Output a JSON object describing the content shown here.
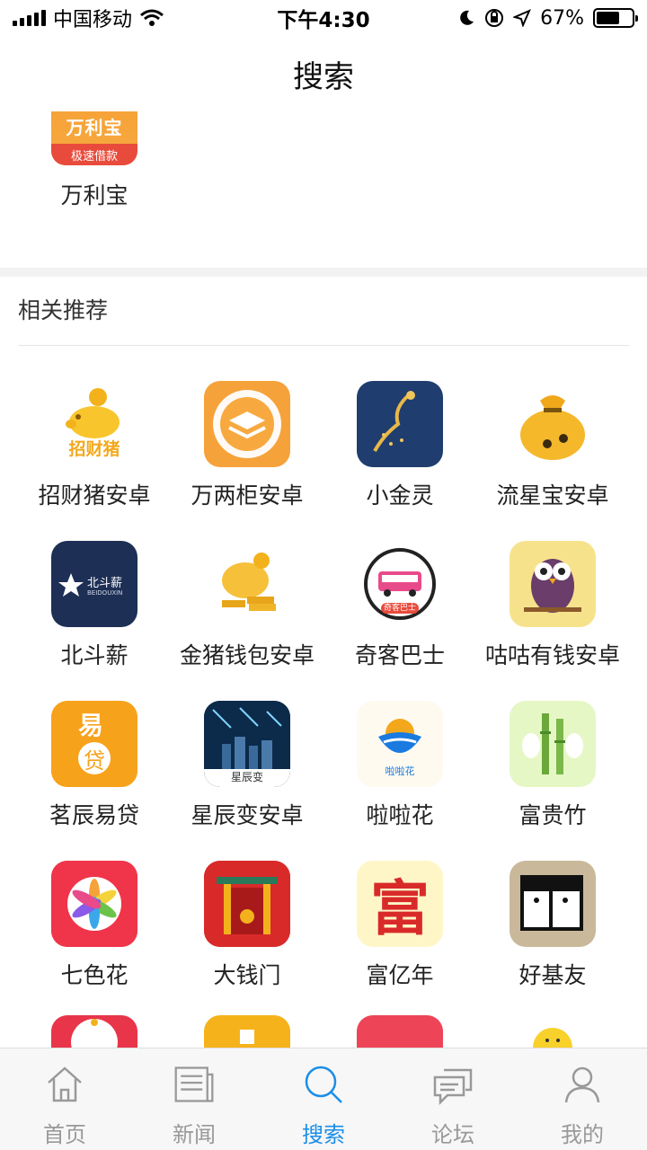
{
  "status_bar": {
    "carrier": "中国移动",
    "time": "下午4:30",
    "battery_text": "67%",
    "battery_level": 0.67
  },
  "header": {
    "title": "搜索"
  },
  "top_result": {
    "name": "万利宝",
    "icon_text_top": "万利宝",
    "icon_text_bottom": "极速借款"
  },
  "section": {
    "title": "相关推荐"
  },
  "apps": [
    {
      "name": "招财猪安卓",
      "icon": "pig-coin-icon",
      "icon_text": "招财猪",
      "bg": "#ffffff"
    },
    {
      "name": "万两柜安卓",
      "icon": "layers-icon",
      "bg": "#f6a23a"
    },
    {
      "name": "小金灵",
      "icon": "golden-fairy-icon",
      "bg": "#1f3d6e"
    },
    {
      "name": "流星宝安卓",
      "icon": "money-bag-icon",
      "bg": "#ffffff"
    },
    {
      "name": "北斗薪",
      "icon": "star-logo-icon",
      "icon_text": "北斗薪",
      "icon_subtext": "BEIDOUXIN",
      "bg": "#1d2f55"
    },
    {
      "name": "金猪钱包安卓",
      "icon": "gold-pig-icon",
      "bg": "#ffffff"
    },
    {
      "name": "奇客巴士",
      "icon": "bus-icon",
      "icon_text": "奇客巴士",
      "bg": "#ffffff"
    },
    {
      "name": "咕咕有钱安卓",
      "icon": "owl-icon",
      "bg": "#f7e28c"
    },
    {
      "name": "茗辰易贷",
      "icon": "loan-card-icon",
      "icon_text": "易",
      "icon_subtext": "贷",
      "bg": "#f7a21b"
    },
    {
      "name": "星辰变安卓",
      "icon": "night-city-icon",
      "icon_text": "星辰变",
      "bg": "#0c2a4a"
    },
    {
      "name": "啦啦花",
      "icon": "wave-logo-icon",
      "icon_text": "啦啦花",
      "bg": "#fffaf0"
    },
    {
      "name": "富贵竹",
      "icon": "bamboo-icon",
      "bg": "#e6f7c6"
    },
    {
      "name": "七色花",
      "icon": "flower-icon",
      "bg": "#f0344a"
    },
    {
      "name": "大钱门",
      "icon": "gate-icon",
      "bg": "#d92a2a"
    },
    {
      "name": "富亿年",
      "icon": "fu-character-icon",
      "icon_text": "富",
      "bg": "#fff6c8"
    },
    {
      "name": "好基友",
      "icon": "two-faces-icon",
      "bg": "#c9b99a"
    }
  ],
  "partial_apps": [
    {
      "icon": "lucky-cat-icon",
      "bg": "#e8354a"
    },
    {
      "icon": "yellow-app-icon",
      "bg": "#f6b21a"
    },
    {
      "icon": "red-app-icon",
      "bg": "#ee4458"
    },
    {
      "icon": "yellow-smiley-icon",
      "bg": "#ffffff"
    }
  ],
  "tabs": [
    {
      "label": "首页",
      "icon": "home-icon",
      "active": false
    },
    {
      "label": "新闻",
      "icon": "newspaper-icon",
      "active": false
    },
    {
      "label": "搜索",
      "icon": "search-icon",
      "active": true
    },
    {
      "label": "论坛",
      "icon": "chat-icon",
      "active": false
    },
    {
      "label": "我的",
      "icon": "user-icon",
      "active": false
    }
  ],
  "colors": {
    "accent": "#1a8ee8",
    "tab_inactive": "#999999"
  }
}
